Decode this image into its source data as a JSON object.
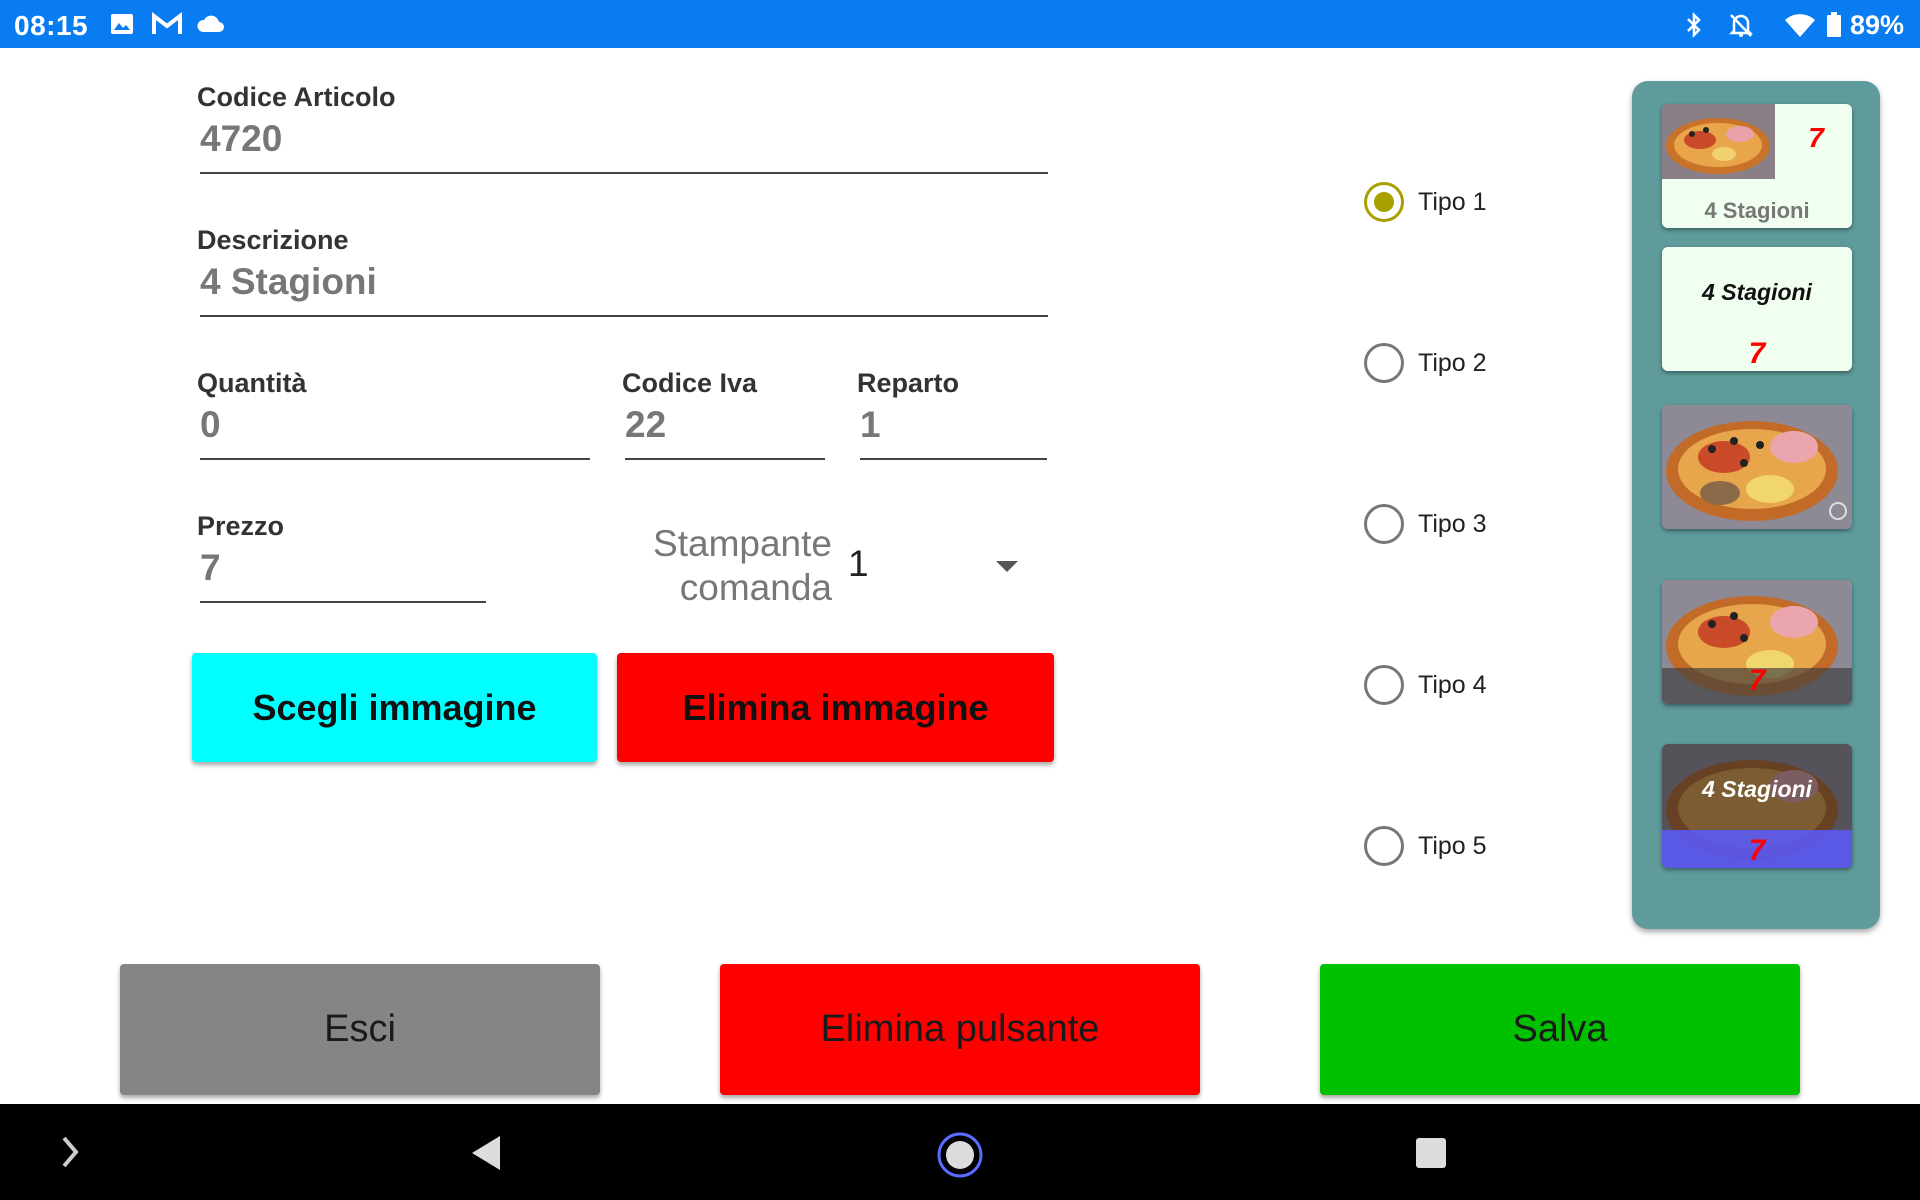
{
  "status_bar": {
    "time": "08:15",
    "battery": "89%",
    "icons": [
      "image-icon",
      "gmail-icon",
      "cloud-icon",
      "bluetooth-icon",
      "notifications-off-icon",
      "wifi-icon",
      "battery-icon"
    ]
  },
  "form": {
    "codice_articolo": {
      "label": "Codice Articolo",
      "value": "4720"
    },
    "descrizione": {
      "label": "Descrizione",
      "value": "4 Stagioni"
    },
    "quantita": {
      "label": "Quantità",
      "value": "0"
    },
    "codice_iva": {
      "label": "Codice Iva",
      "value": "22"
    },
    "reparto": {
      "label": "Reparto",
      "value": "1"
    },
    "prezzo": {
      "label": "Prezzo",
      "value": "7"
    },
    "stampante": {
      "label_line1": "Stampante",
      "label_line2": "comanda",
      "value": "1"
    }
  },
  "image_buttons": {
    "choose": "Scegli immagine",
    "delete": "Elimina immagine"
  },
  "types": [
    {
      "label": "Tipo 1",
      "selected": true
    },
    {
      "label": "Tipo 2",
      "selected": false
    },
    {
      "label": "Tipo 3",
      "selected": false
    },
    {
      "label": "Tipo 4",
      "selected": false
    },
    {
      "label": "Tipo 5",
      "selected": false
    }
  ],
  "previews": {
    "tile1": {
      "title": "4 Stagioni",
      "price": "7"
    },
    "tile2": {
      "title": "4 Stagioni",
      "price": "7"
    },
    "tile4": {
      "price": "7"
    },
    "tile5": {
      "title": "4 Stagioni",
      "price": "7"
    }
  },
  "footer": {
    "exit": "Esci",
    "delete_button": "Elimina pulsante",
    "save": "Salva"
  },
  "colors": {
    "status_bar": "#0a7cf2",
    "choose_image": "#00ffff",
    "delete_image": "#ff0000",
    "exit": "#858585",
    "delete_button": "#ff0000",
    "save": "#00c000",
    "radio_selected": "#a6a000",
    "panel": "#5f9b9b"
  }
}
